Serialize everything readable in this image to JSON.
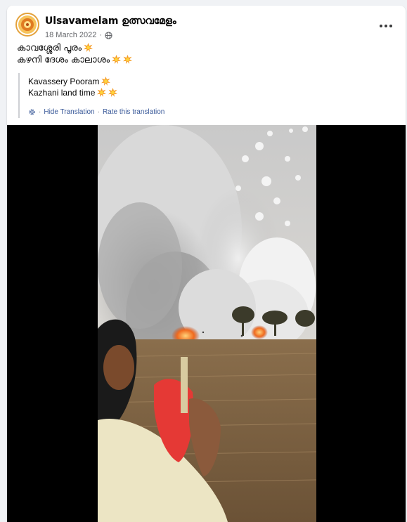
{
  "post": {
    "page_name": "Ulsavamelam ഉത്സവമേളം",
    "date": "18 March 2022",
    "privacy_icon": "globe-icon",
    "more_icon": "more-options-icon",
    "text_lines": [
      "കാവശ്ശേരി പൂരം",
      "കഴനി ദേശം കാലാശം"
    ],
    "translation": {
      "lines": [
        "Kavassery Pooram",
        "Kazhani land time"
      ],
      "hide_label": "Hide Translation",
      "separator": "·",
      "rate_label": "Rate this translation"
    }
  },
  "colors": {
    "link": "#385898",
    "secondary_text": "#65676b",
    "background": "#f0f2f5"
  }
}
